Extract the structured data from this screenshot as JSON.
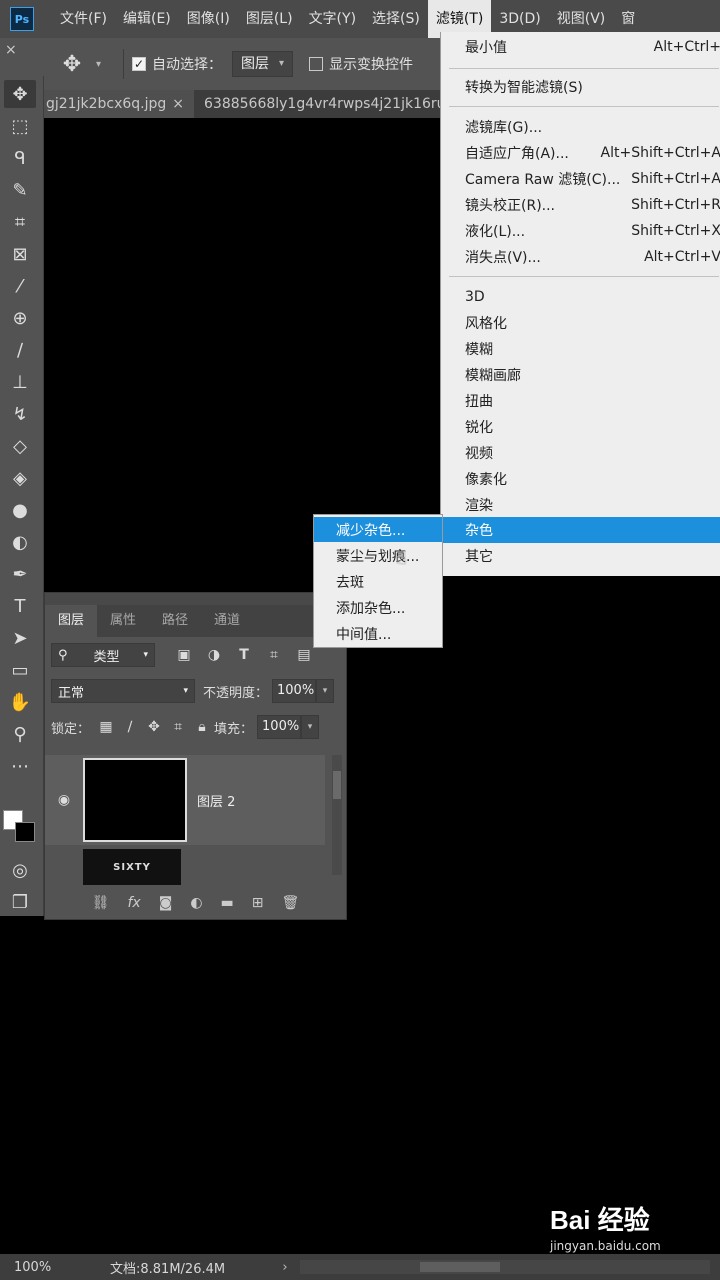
{
  "app": {
    "logo": "Ps",
    "menu": [
      "文件(F)",
      "编辑(E)",
      "图像(I)",
      "图层(L)",
      "文字(Y)",
      "选择(S)",
      "滤镜(T)",
      "3D(D)",
      "视图(V)",
      "窗"
    ]
  },
  "options_bar": {
    "auto_select_label": "自动选择：",
    "auto_select_checked": true,
    "target_value": "图层",
    "show_transform_label": "显示变换控件",
    "show_transform_checked": false
  },
  "tabs": [
    {
      "label": "gj21jk2bcx6q.jpg",
      "close": "×"
    },
    {
      "label": "63885668ly1g4vr4rwps4j21jk16ru"
    }
  ],
  "filter_menu": {
    "items": [
      {
        "label": "最小值",
        "shortcut": "Alt+Ctrl+"
      },
      {
        "label": "转换为智能滤镜(S)",
        "shortcut": ""
      },
      {
        "label": "滤镜库(G)...",
        "shortcut": ""
      },
      {
        "label": "自适应广角(A)...",
        "shortcut": "Alt+Shift+Ctrl+A"
      },
      {
        "label": "Camera Raw 滤镜(C)...",
        "shortcut": "Shift+Ctrl+A"
      },
      {
        "label": "镜头校正(R)...",
        "shortcut": "Shift+Ctrl+R"
      },
      {
        "label": "液化(L)...",
        "shortcut": "Shift+Ctrl+X"
      },
      {
        "label": "消失点(V)...",
        "shortcut": "Alt+Ctrl+V"
      },
      {
        "label": "3D",
        "shortcut": ""
      },
      {
        "label": "风格化",
        "shortcut": ""
      },
      {
        "label": "模糊",
        "shortcut": ""
      },
      {
        "label": "模糊画廊",
        "shortcut": ""
      },
      {
        "label": "扭曲",
        "shortcut": ""
      },
      {
        "label": "锐化",
        "shortcut": ""
      },
      {
        "label": "视频",
        "shortcut": ""
      },
      {
        "label": "像素化",
        "shortcut": ""
      },
      {
        "label": "渲染",
        "shortcut": ""
      },
      {
        "label": "杂色",
        "shortcut": ""
      },
      {
        "label": "其它",
        "shortcut": ""
      }
    ],
    "active_item": "杂色"
  },
  "noise_submenu": {
    "items": [
      "减少杂色...",
      "蒙尘与划痕...",
      "去斑",
      "添加杂色...",
      "中间值..."
    ],
    "active_item": "减少杂色..."
  },
  "layers_panel": {
    "tabs": [
      "图层",
      "属性",
      "路径",
      "通道"
    ],
    "filter_kind": "类型",
    "blend_mode": "正常",
    "opacity_label": "不透明度：",
    "opacity": "100%",
    "lock_label": "锁定：",
    "fill_label": "填充：",
    "fill": "100%",
    "layers": [
      {
        "name": "图层 2",
        "visible": true
      },
      {
        "name": "",
        "thumb_text": "SIXTY",
        "visible": false
      }
    ]
  },
  "status": {
    "zoom": "100%",
    "doc": "文档:8.81M/26.4M",
    "arrow": "›"
  },
  "watermark": {
    "brand": "Bai 经验",
    "url": "jingyan.baidu.com"
  },
  "colors": {
    "menu_highlight": "#1c8fdd",
    "panel_bg": "#535353",
    "menu_bg": "#eeeeee"
  }
}
